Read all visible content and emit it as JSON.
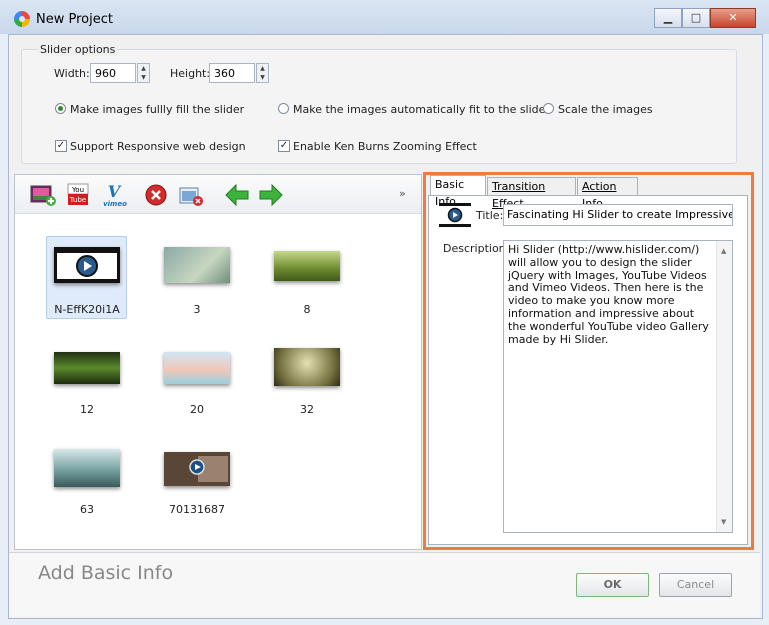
{
  "window": {
    "title": "New Project"
  },
  "slider_options": {
    "legend": "Slider options",
    "width_label": "Width:",
    "width_value": "960",
    "height_label": "Height:",
    "height_value": "360",
    "radios": [
      {
        "label": "Make images fullly fill the slider",
        "checked": true
      },
      {
        "label": "Make the images automatically fit to the slider",
        "checked": false
      },
      {
        "label": "Scale the images",
        "checked": false
      }
    ],
    "checkboxes": [
      {
        "label": "Support Responsive web design",
        "checked": true
      },
      {
        "label": "Enable Ken Burns Zooming Effect",
        "checked": true
      }
    ]
  },
  "toolbar": {
    "youtube_icon_text_1": "You",
    "youtube_icon_text_2": "Tube",
    "vimeo_icon_text": "vimeo",
    "overflow": "»"
  },
  "thumbnails": [
    {
      "caption": "N-EffK20i1A",
      "selected": true
    },
    {
      "caption": "3"
    },
    {
      "caption": "8"
    },
    {
      "caption": "12"
    },
    {
      "caption": "20"
    },
    {
      "caption": "32"
    },
    {
      "caption": "63"
    },
    {
      "caption": "70131687"
    }
  ],
  "tabs": [
    {
      "label": "Basic Info",
      "active": true
    },
    {
      "label": "Transition Effect",
      "active": false
    },
    {
      "label": "Action Info",
      "active": false
    }
  ],
  "basic_info": {
    "title_label": "Title:",
    "title_value": "Fascinating Hi Slider to create Impressive YouT",
    "description_label": "Description:",
    "description_value": "Hi Slider (http://www.hislider.com/) will allow you to design the slider jQuery with Images, YouTube Videos and Vimeo Videos. Then here is the video to make you know more information and impressive about the wonderful YouTube video Gallery made by Hi Slider."
  },
  "footer": {
    "hint": "Add Basic Info",
    "ok_label": "OK",
    "cancel_label": "Cancel"
  },
  "colors": {
    "highlight_border": "#f07b3f",
    "ok_border": "#7fb67f"
  }
}
